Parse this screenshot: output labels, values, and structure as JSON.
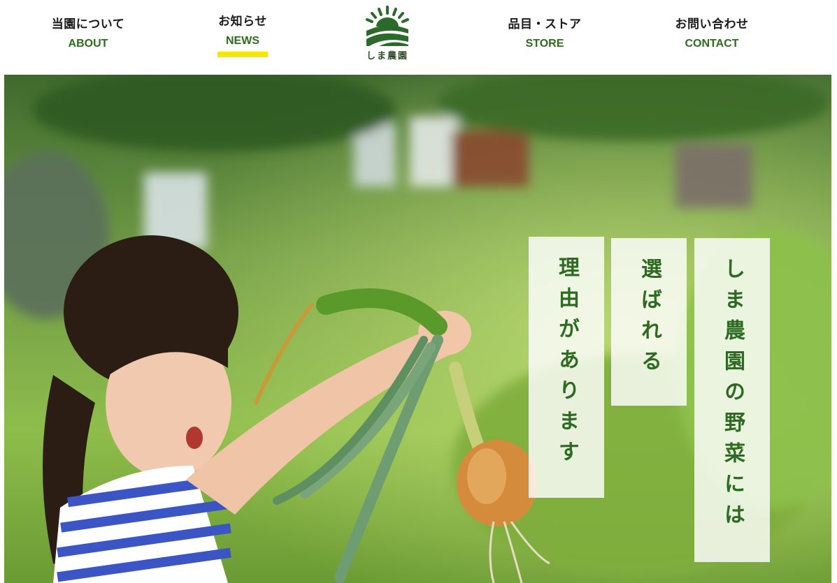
{
  "nav": {
    "items": [
      {
        "ja": "当園について",
        "en": "ABOUT"
      },
      {
        "ja": "お知らせ",
        "en": "NEWS"
      },
      {
        "ja": "品目・ストア",
        "en": "STORE"
      },
      {
        "ja": "お問い合わせ",
        "en": "CONTACT"
      }
    ],
    "active_item": "NEWS"
  },
  "logo": {
    "text": "しま農園",
    "icon": "farm-sun-field-icon"
  },
  "hero": {
    "image": "girl-holding-onion-in-field-photo",
    "catchphrase": [
      "しま農園の野菜には",
      "選ばれる",
      "理由があります"
    ]
  },
  "colors": {
    "brand_green": "#2e6b1f",
    "catch_green": "#2d6a22",
    "active_underline": "#f5e600",
    "nav_text": "#1a1a1a"
  }
}
